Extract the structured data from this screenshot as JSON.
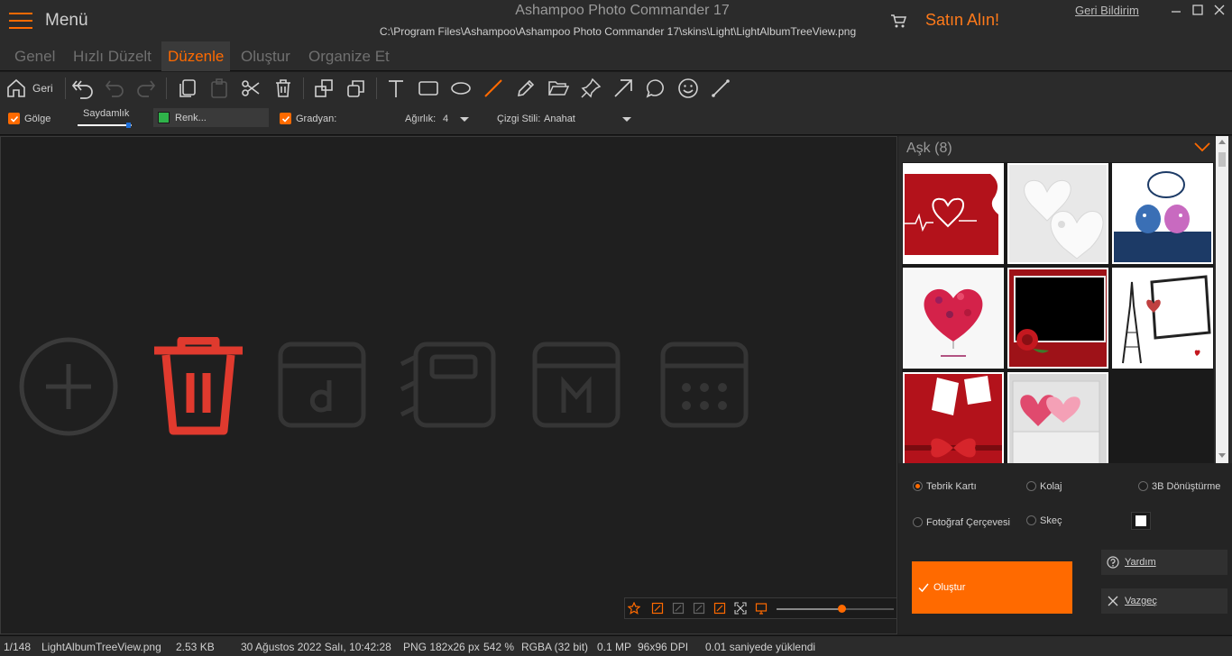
{
  "titlebar": {
    "menu_label": "Menü",
    "app_title": "Ashampoo Photo Commander 17",
    "path": "C:\\Program Files\\Ashampoo\\Ashampoo Photo Commander 17\\skins\\Light\\LightAlbumTreeView.png",
    "buy_label": "Satın Alın!",
    "feedback_label": "Geri Bildirim"
  },
  "tabs": [
    {
      "label": "Genel",
      "active": false
    },
    {
      "label": "Hızlı Düzelt",
      "active": false
    },
    {
      "label": "Düzenle",
      "active": true
    },
    {
      "label": "Oluştur",
      "active": false
    },
    {
      "label": "Organize Et",
      "active": false
    }
  ],
  "toolbar": {
    "back_label": "Geri",
    "icons": [
      "home-icon",
      "undo-all-icon",
      "undo-icon",
      "redo-icon",
      "copy-icon",
      "paste-icon",
      "cut-icon",
      "delete-icon",
      "bring-front-icon",
      "send-back-icon",
      "text-tool-icon",
      "rectangle-tool-icon",
      "ellipse-tool-icon",
      "line-tool-icon",
      "pencil-tool-icon",
      "open-folder-icon",
      "pin-icon",
      "arrow-tool-icon",
      "speech-bubble-icon",
      "smiley-icon",
      "straight-line-icon"
    ]
  },
  "options": {
    "shadow_label": "Gölge",
    "shadow_checked": true,
    "transparency_label": "Saydamlık",
    "transparency_level": 0.95,
    "color_label": "Renk...",
    "color_value": "#2fb34a",
    "gradient_label": "Gradyan:",
    "gradient_checked": true,
    "weight_label": "Ağırlık:",
    "weight_value": "4",
    "line_style_label": "Çizgi Stili:",
    "line_style_value": "Anahat"
  },
  "canvas": {
    "icons": [
      "plus-circle-icon",
      "trash-icon",
      "calendar-d-icon",
      "notebook-icon",
      "calendar-m-icon",
      "calendar-grid-icon"
    ],
    "zoom_level": 0.55
  },
  "album": {
    "title": "Aşk (8)",
    "thumbnails": [
      "love-card-heartbeat",
      "love-card-white-hearts",
      "love-card-birds",
      "love-card-heart-balloons",
      "love-card-rose-frame",
      "love-card-eiffel",
      "love-card-red-bow",
      "love-card-envelope"
    ]
  },
  "types": {
    "greeting_card": "Tebrik Kartı",
    "collage": "Kolaj",
    "threed": "3B Dönüştürme",
    "photo_frame": "Fotoğraf Çerçevesi",
    "sketch": "Skeç",
    "selected": "greeting_card"
  },
  "actions": {
    "create_label": "Oluştur",
    "help_label": "Yardım",
    "cancel_label": "Vazgeç"
  },
  "status": {
    "index": "1/148",
    "filename": "LightAlbumTreeView.png",
    "size": "2.53 KB",
    "date": "30 Ağustos 2022 Salı, 10:42:28",
    "format": "PNG 182x26 px",
    "zoom": "542 %",
    "color_mode": "RGBA (32 bit)",
    "megapixels": "0.1 MP",
    "dpi": "96x96 DPI",
    "load_time": "0.01 saniyede yüklendi"
  },
  "colors": {
    "accent": "#ff6a00",
    "background": "#1e1e1e",
    "panel": "#2b2b2b",
    "trash_red": "#e03a2e"
  }
}
